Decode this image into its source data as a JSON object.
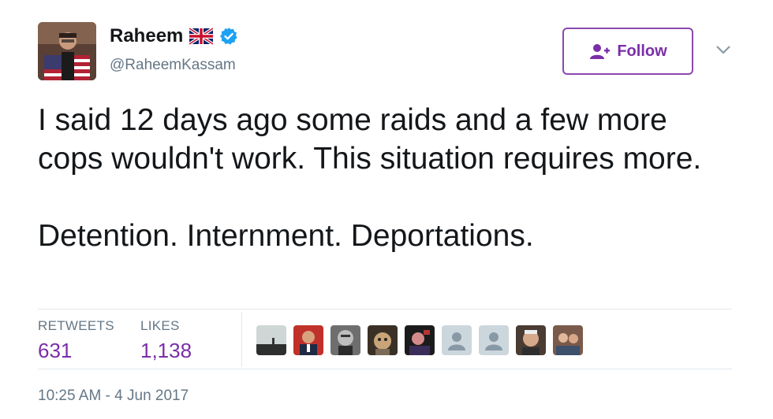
{
  "user": {
    "display_name": "Raheem",
    "handle": "@RaheemKassam",
    "flag_icon": "uk-flag-icon",
    "verified_icon": "verified-badge-icon",
    "verified_color": "#1da1f2"
  },
  "follow_button": {
    "label": "Follow",
    "color": "#7a2ea8"
  },
  "tweet": {
    "paragraph_1": "I said 12 days ago some raids and a few more cops wouldn't work. This situation requires more.",
    "paragraph_2": "Detention. Internment. Deportations."
  },
  "stats": {
    "retweets_label": "RETWEETS",
    "retweets_count": "631",
    "likes_label": "LIKES",
    "likes_count": "1,138"
  },
  "likers_count": 10,
  "timestamp": "10:25 AM - 4 Jun 2017"
}
